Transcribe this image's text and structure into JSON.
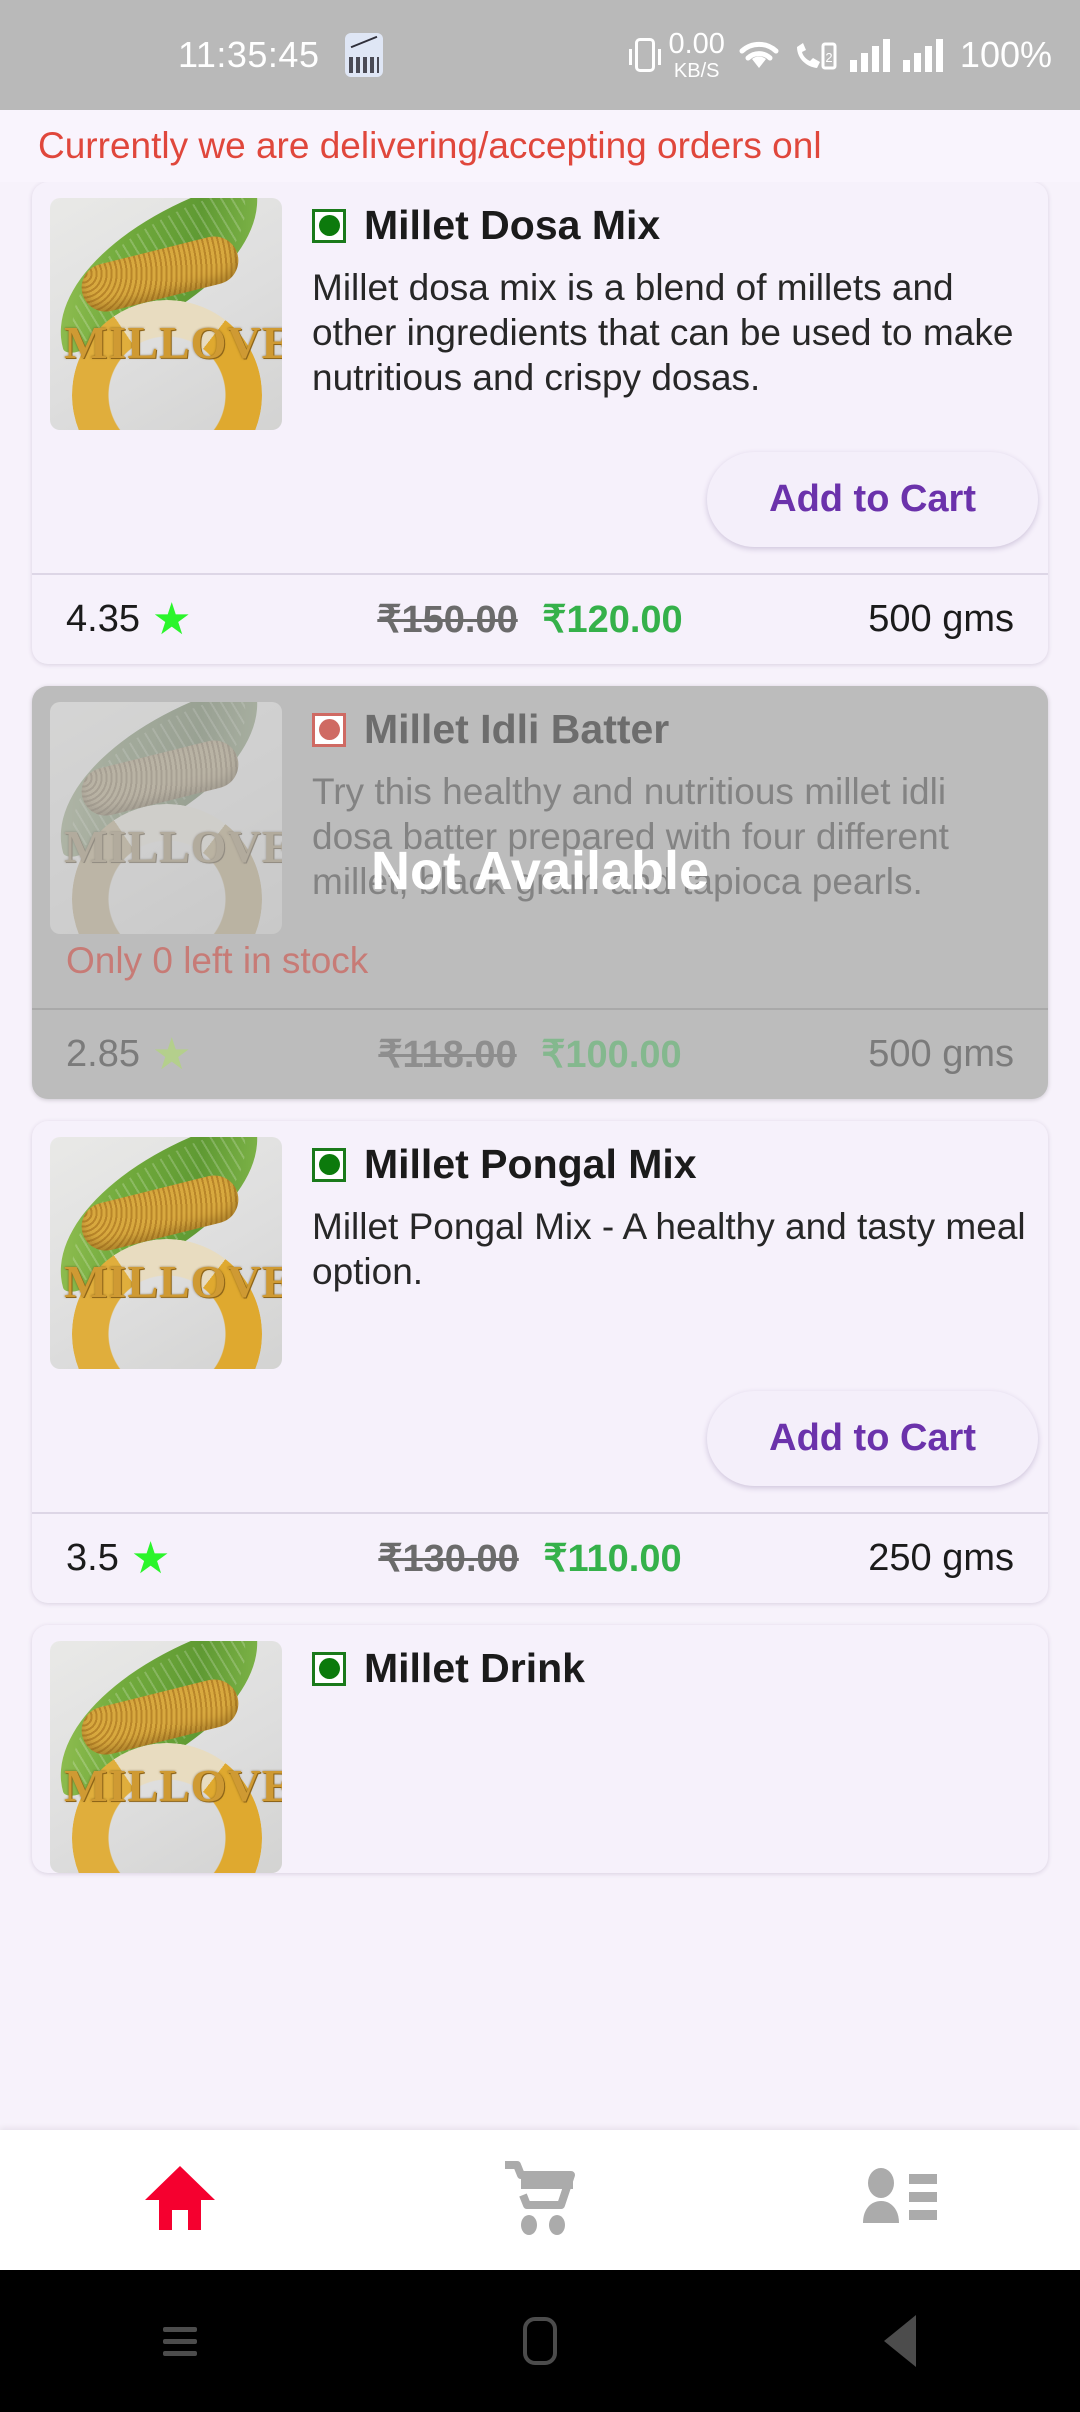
{
  "statusbar": {
    "time": "11:35:45",
    "app_icon": "stock-chart-icon",
    "vibrate_icon": "vibrate-icon",
    "net_speed_value": "0.00",
    "net_speed_unit": "KB/S",
    "wifi_icon": "wifi-icon",
    "call_icon": "call-signal-icon",
    "sim_label": "2",
    "battery": "100%"
  },
  "notice": {
    "text": "Currently we are delivering/accepting orders onl"
  },
  "products": [
    {
      "id": "millet-dosa-mix",
      "veg": "veg",
      "title": "Millet Dosa Mix",
      "description": "Millet dosa mix is a blend of millets and other ingredients that can be used to make nutritious and crispy dosas.",
      "cta_label": "Add to Cart",
      "rating": "4.35",
      "old_price": "₹150.00",
      "new_price": "₹120.00",
      "weight": "500 gms",
      "available": true,
      "image_logo_text": "MILLOVE"
    },
    {
      "id": "millet-idli-batter",
      "veg": "nonveg",
      "title": "Millet Idli Batter",
      "description": "Try this healthy and nutritious millet idli dosa batter prepared with four different millet, black gram and tapioca pearls.",
      "unavailable_label": "Not Available",
      "stock_label": "Only 0 left in stock",
      "rating": "2.85",
      "old_price": "₹118.00",
      "new_price": "₹100.00",
      "weight": "500 gms",
      "available": false,
      "image_logo_text": "MILLOVE"
    },
    {
      "id": "millet-pongal-mix",
      "veg": "veg",
      "title": "Millet Pongal Mix",
      "description": "Millet Pongal Mix - A healthy and tasty meal option.",
      "cta_label": "Add to Cart",
      "rating": "3.5",
      "old_price": "₹130.00",
      "new_price": "₹110.00",
      "weight": "250 gms",
      "available": true,
      "image_logo_text": "MILLOVE"
    },
    {
      "id": "millet-drink",
      "veg": "veg",
      "title": "Millet Drink",
      "available": true,
      "image_logo_text": "MILLOVE"
    }
  ],
  "bottomnav": {
    "items": [
      {
        "icon": "home-icon",
        "active": true
      },
      {
        "icon": "cart-icon",
        "active": false
      },
      {
        "icon": "account-list-icon",
        "active": false
      }
    ]
  },
  "sysnav": {
    "menu": "menu-icon",
    "home": "home-square-icon",
    "back": "back-triangle-icon"
  },
  "colors": {
    "accent_purple": "#6b32ab",
    "price_green": "#35b14a",
    "notice_red": "#e0473c",
    "home_red": "#f5002f",
    "veg_green": "#0c7a0c",
    "nonveg_red": "#cf6a63"
  }
}
